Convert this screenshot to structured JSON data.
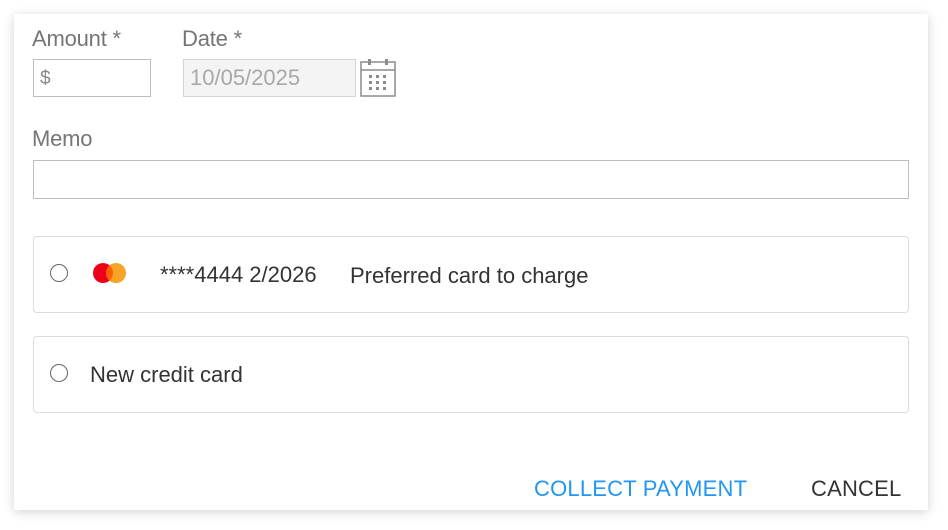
{
  "form": {
    "amount_label": "Amount *",
    "amount_prefix": "$",
    "amount_value": "",
    "date_label": "Date *",
    "date_value": "10/05/2025",
    "memo_label": "Memo",
    "memo_value": ""
  },
  "payment_options": {
    "saved_card": {
      "brand_icon": "mastercard-icon",
      "number": "****4444 2/2026",
      "note": "Preferred card to charge",
      "selected": false
    },
    "new_card": {
      "label": "New credit card",
      "selected": false
    }
  },
  "actions": {
    "collect_label": "COLLECT PAYMENT",
    "cancel_label": "CANCEL"
  },
  "colors": {
    "accent": "#2196f3",
    "mastercard_red": "#eb001b",
    "mastercard_orange": "#f79e1b"
  }
}
